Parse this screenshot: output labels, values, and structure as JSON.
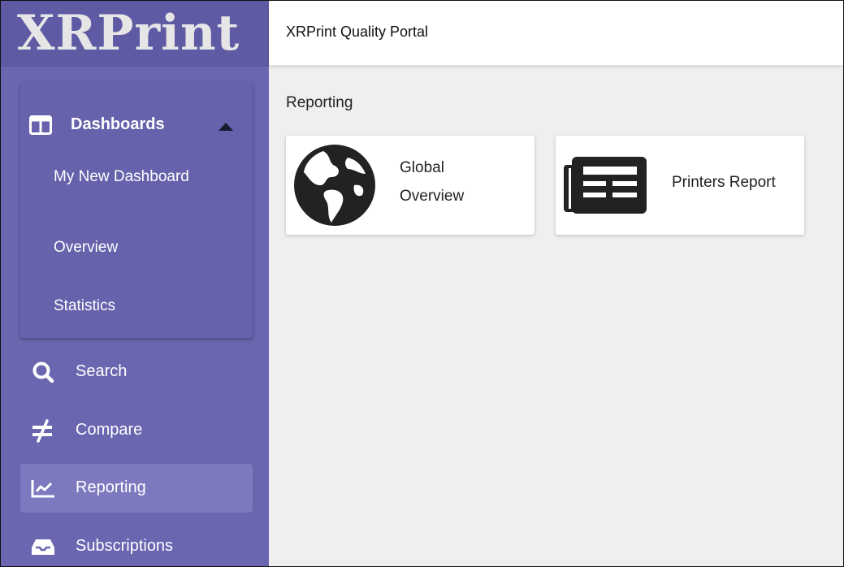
{
  "brand": {
    "logo_text": "XRPrint"
  },
  "header": {
    "title": "XRPrint Quality Portal"
  },
  "sidebar": {
    "dashboards": {
      "label": "Dashboards",
      "icon": "columns-icon",
      "expanded": true,
      "items": [
        {
          "label": "My New Dashboard"
        },
        {
          "label": "Overview"
        },
        {
          "label": "Statistics"
        }
      ]
    },
    "nav": [
      {
        "label": "Search",
        "icon": "search-icon",
        "active": false
      },
      {
        "label": "Compare",
        "icon": "not-equal-icon",
        "active": false
      },
      {
        "label": "Reporting",
        "icon": "chart-line-icon",
        "active": true
      },
      {
        "label": "Subscriptions",
        "icon": "inbox-icon",
        "active": false
      }
    ]
  },
  "main": {
    "section_title": "Reporting",
    "cards": [
      {
        "label": "Global Overview",
        "icon": "globe-icon"
      },
      {
        "label": "Printers Report",
        "icon": "newspaper-icon"
      }
    ]
  },
  "colors": {
    "sidebar": "#6a66b0",
    "logo_bg": "#5e5aa4",
    "active_item": "#7d79bf",
    "content_bg": "#efefef",
    "icon_dark": "#222222"
  }
}
